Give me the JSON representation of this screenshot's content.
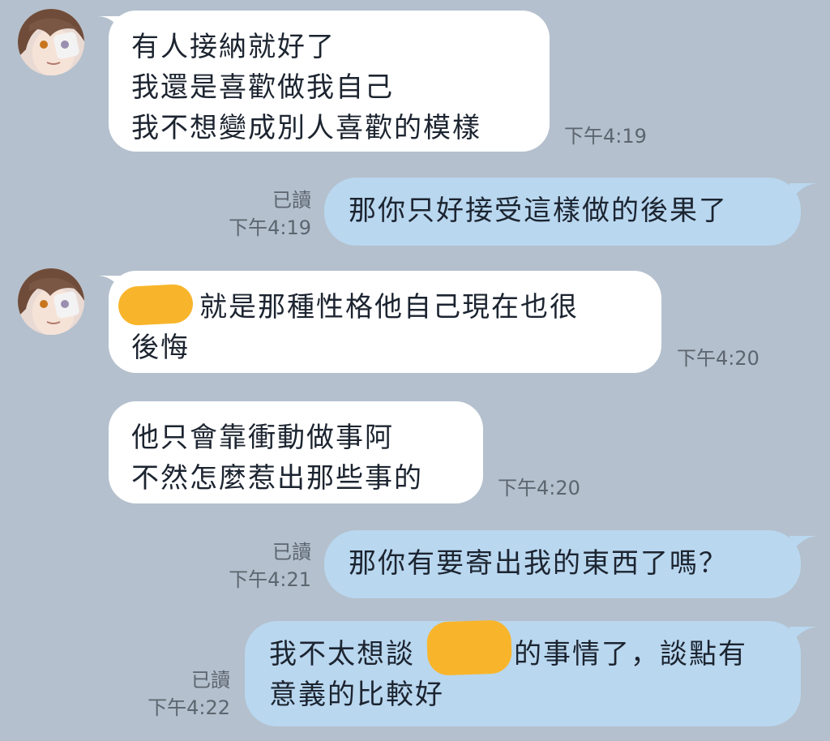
{
  "messages": [
    {
      "id": "m1",
      "direction": "incoming",
      "lines": [
        "有人接納就好了",
        "我還是喜歡做我自己",
        "我不想變成別人喜歡的模樣"
      ],
      "time": "下午4:19"
    },
    {
      "id": "m2",
      "direction": "outgoing",
      "lines": [
        "那你只好接受這樣做的後果了"
      ],
      "read": "已讀",
      "time": "下午4:19"
    },
    {
      "id": "m3",
      "direction": "incoming",
      "lines": [
        "就是那種性格他自己現在也很",
        "後悔"
      ],
      "redacted": true,
      "time": "下午4:20"
    },
    {
      "id": "m4",
      "direction": "incoming",
      "lines": [
        "他只會靠衝動做事阿",
        "不然怎麼惹出那些事的"
      ],
      "time": "下午4:20"
    },
    {
      "id": "m5",
      "direction": "outgoing",
      "lines": [
        "那你有要寄出我的東西了嗎？"
      ],
      "read": "已讀",
      "time": "下午4:21"
    },
    {
      "id": "m6",
      "direction": "outgoing",
      "lines": [
        "我不太想談",
        "的事情了，談點有",
        "意義的比較好"
      ],
      "redacted": true,
      "read": "已讀",
      "time": "下午4:22"
    }
  ],
  "colors": {
    "background": "#b4c0cd",
    "incoming_bubble": "#ffffff",
    "outgoing_bubble": "#b9d7ef",
    "redaction": "#f8b52b",
    "meta_text": "#5c6570"
  }
}
